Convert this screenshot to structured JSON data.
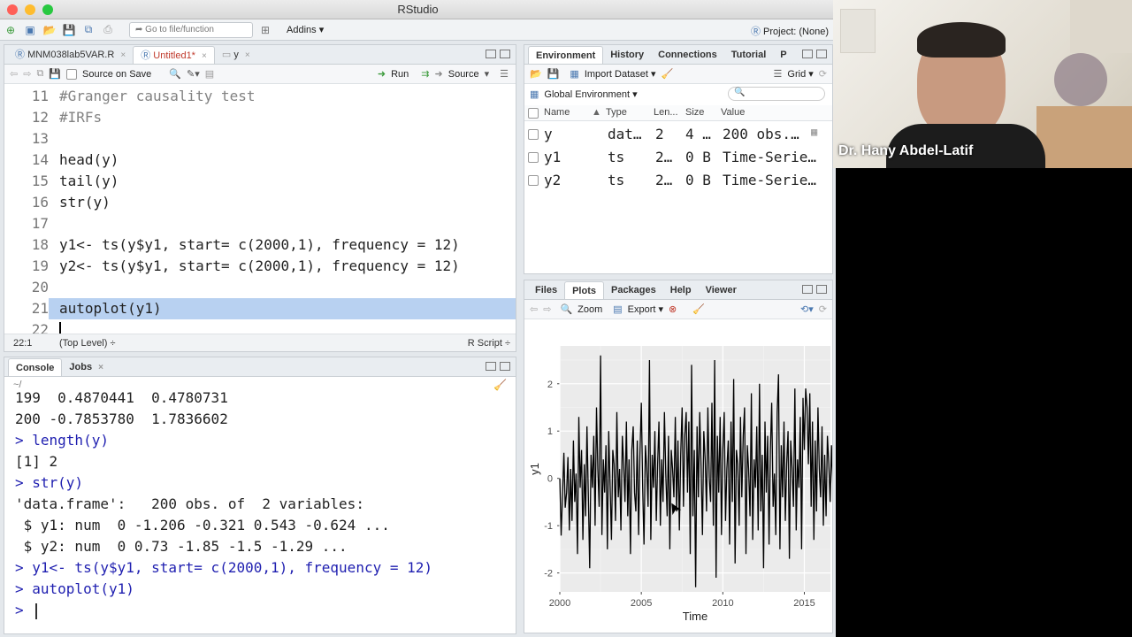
{
  "window": {
    "title": "RStudio",
    "project": "Project: (None)"
  },
  "toolbar": {
    "goto_placeholder": "Go to file/function",
    "addins": "Addins"
  },
  "editor": {
    "tabs": [
      {
        "label": "MNM038lab5VAR.R"
      },
      {
        "label": "Untitled1*"
      },
      {
        "label": "y"
      }
    ],
    "source_on_save": "Source on Save",
    "run": "Run",
    "source": "Source",
    "lines": [
      {
        "n": "11",
        "text": "#Granger causality test"
      },
      {
        "n": "12",
        "text": "#IRFs"
      },
      {
        "n": "13",
        "text": ""
      },
      {
        "n": "14",
        "text": "head(y)"
      },
      {
        "n": "15",
        "text": "tail(y)"
      },
      {
        "n": "16",
        "text": "str(y)"
      },
      {
        "n": "17",
        "text": ""
      },
      {
        "n": "18",
        "text": "y1<- ts(y$y1, start= c(2000,1), frequency = 12)"
      },
      {
        "n": "19",
        "text": "y2<- ts(y$y1, start= c(2000,1), frequency = 12)"
      },
      {
        "n": "20",
        "text": ""
      },
      {
        "n": "21",
        "text": "autoplot(y1)"
      },
      {
        "n": "22",
        "text": ""
      }
    ],
    "status_pos": "22:1",
    "status_scope": "(Top Level) ÷",
    "status_type": "R Script ÷"
  },
  "console": {
    "tabs": [
      {
        "label": "Console"
      },
      {
        "label": "Jobs"
      }
    ],
    "path": "~/",
    "lines": [
      {
        "kind": "out",
        "text": "199  0.4870441  0.4780731"
      },
      {
        "kind": "out",
        "text": "200 -0.7853780  1.7836602"
      },
      {
        "kind": "in",
        "text": "> length(y)"
      },
      {
        "kind": "out",
        "text": "[1] 2"
      },
      {
        "kind": "in",
        "text": "> str(y)"
      },
      {
        "kind": "out",
        "text": "'data.frame':   200 obs. of  2 variables:"
      },
      {
        "kind": "out",
        "text": " $ y1: num  0 -1.206 -0.321 0.543 -0.624 ..."
      },
      {
        "kind": "out",
        "text": " $ y2: num  0 0.73 -1.85 -1.5 -1.29 ..."
      },
      {
        "kind": "in",
        "text": "> y1<- ts(y$y1, start= c(2000,1), frequency = 12)"
      },
      {
        "kind": "in",
        "text": "> autoplot(y1)"
      },
      {
        "kind": "in",
        "text": "> "
      }
    ]
  },
  "environment": {
    "tabs": [
      {
        "label": "Environment"
      },
      {
        "label": "History"
      },
      {
        "label": "Connections"
      },
      {
        "label": "Tutorial"
      },
      {
        "label": "P"
      }
    ],
    "import_dataset": "Import Dataset",
    "grid": "Grid",
    "scope": "Global Environment",
    "columns": [
      "Name",
      "Type",
      "Len...",
      "Size",
      "Value"
    ],
    "rows": [
      {
        "name": "y",
        "type": "dat…",
        "len": "2",
        "size": "4 …",
        "value": "200 obs.…"
      },
      {
        "name": "y1",
        "type": "ts",
        "len": "2…",
        "size": "0 B",
        "value": "Time-Serie…"
      },
      {
        "name": "y2",
        "type": "ts",
        "len": "2…",
        "size": "0 B",
        "value": "Time-Serie…"
      }
    ]
  },
  "files": {
    "tabs": [
      {
        "label": "Files"
      },
      {
        "label": "Plots"
      },
      {
        "label": "Packages"
      },
      {
        "label": "Help"
      },
      {
        "label": "Viewer"
      }
    ],
    "zoom": "Zoom",
    "export": "Export"
  },
  "webcam": {
    "caption": "Dr. Hany Abdel-Latif"
  },
  "colors": {
    "accent": "#4a78b0",
    "selection": "#b8d1f1",
    "console_input": "#1f1fb0",
    "plot_bg": "#ebebeb"
  },
  "chart_data": {
    "type": "line",
    "xlabel": "Time",
    "ylabel": "y1",
    "xticks": [
      2000,
      2005,
      2010,
      2015
    ],
    "yticks": [
      -2,
      -1,
      0,
      1,
      2
    ],
    "xlim": [
      2000,
      2016.6
    ],
    "ylim": [
      -2.4,
      2.8
    ],
    "grid": true,
    "series": [
      {
        "start": 2000,
        "frequency": 12,
        "values": [
          0,
          -1.21,
          -0.32,
          0.54,
          -0.62,
          -0.3,
          0.45,
          -1.1,
          0.2,
          -0.9,
          0.8,
          -0.5,
          0.1,
          -1.6,
          1.3,
          -0.2,
          0.6,
          -1.3,
          0.3,
          -0.8,
          1.1,
          -0.4,
          -1.9,
          0.5,
          -0.2,
          0.9,
          -1.0,
          1.5,
          0.2,
          -0.6,
          2.6,
          -1.2,
          0.4,
          -0.3,
          0.7,
          -1.5,
          1.0,
          -0.1,
          -1.3,
          0.6,
          0.3,
          -0.9,
          1.4,
          -0.4,
          0.2,
          -1.1,
          0.9,
          0.3,
          -0.5,
          1.2,
          -0.8,
          0.4,
          -1.6,
          0.6,
          1.1,
          -0.3,
          -0.7,
          0.8,
          -1.2,
          0.5,
          1.6,
          -0.2,
          -1.4,
          0.7,
          0.2,
          -0.6,
          2.5,
          -1.3,
          0.5,
          -0.2,
          1.0,
          -0.9,
          0.3,
          1.2,
          -1.0,
          0.4,
          -0.5,
          1.4,
          0.1,
          -0.8,
          0.9,
          -1.5,
          0.6,
          0.2,
          -0.4,
          1.3,
          -0.7,
          0.8,
          -1.1,
          0.5,
          1.5,
          -0.6,
          0.9,
          1.4,
          -0.3,
          1.2,
          -1.6,
          2.4,
          -0.8,
          0.6,
          -2.3,
          1.1,
          -0.4,
          1.4,
          0.2,
          -1.2,
          1.0,
          0.4,
          -0.7,
          1.5,
          0.0,
          -0.5,
          1.6,
          -1.0,
          2.5,
          -2.1,
          0.9,
          -0.3,
          1.3,
          -1.2,
          0.6,
          1.4,
          -0.9,
          0.2,
          0.8,
          -1.4,
          1.2,
          -0.5,
          2.1,
          -1.8,
          0.6,
          0.3,
          -1.0,
          1.3,
          -0.4,
          0.9,
          1.5,
          -1.6,
          0.7,
          0.2,
          -0.8,
          1.8,
          -1.3,
          0.4,
          -0.2,
          1.1,
          -1.1,
          2.0,
          -0.7,
          0.5,
          -1.9,
          1.2,
          -0.3,
          0.9,
          -1.4,
          0.6,
          1.6,
          -0.6,
          0.1,
          -1.2,
          1.4,
          2.2,
          -1.5,
          0.7,
          -0.4,
          1.2,
          -0.9,
          0.3,
          1.0,
          -1.7,
          0.8,
          0.2,
          -0.6,
          1.9,
          -1.1,
          0.4,
          -0.2,
          1.3,
          -1.5,
          1.7,
          0.6,
          1.9,
          1.5,
          0.3,
          1.8,
          -0.6,
          1.2,
          -1.3,
          0.8,
          -0.7,
          1.5,
          0.2,
          -0.4,
          1.1,
          -1.0,
          0.5,
          -0.8,
          0.9,
          0.3,
          -0.5,
          0.7,
          -0.2,
          0.4,
          -0.78
        ]
      }
    ]
  }
}
